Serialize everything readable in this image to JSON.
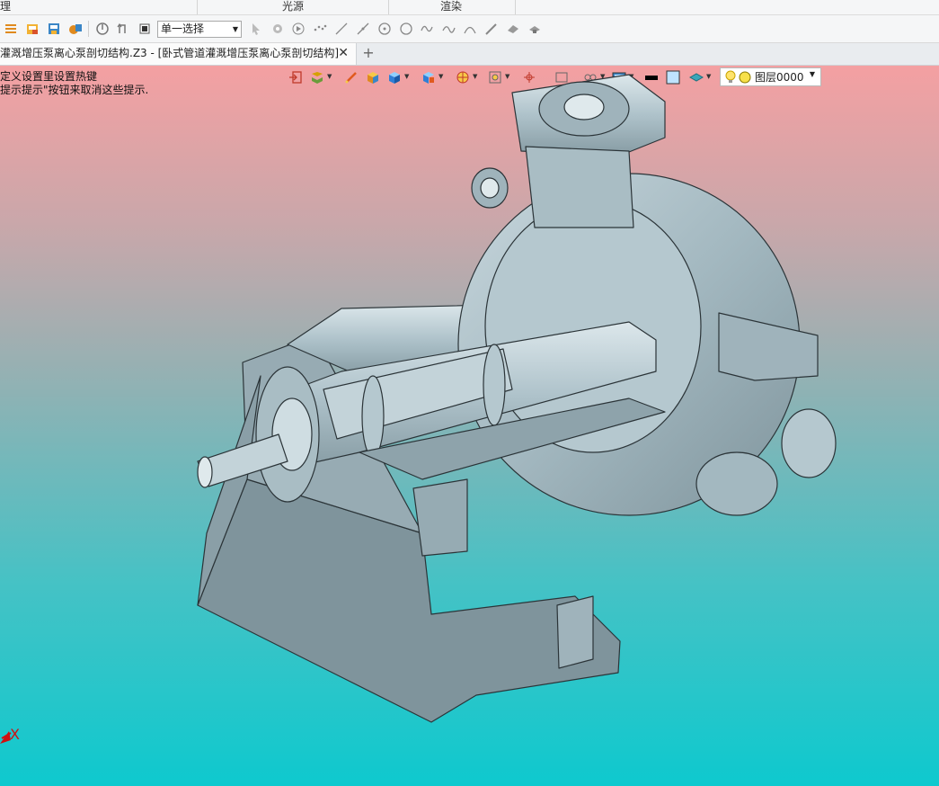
{
  "ribbon": {
    "groups": [
      "理",
      "光源",
      "渲染"
    ]
  },
  "toolbar": {
    "select_mode": "单一选择",
    "icons": [
      "new-icon",
      "open-icon",
      "save-icon",
      "recent-icon",
      "rotate-icon",
      "undo-icon",
      "stop-icon",
      "pick-icon",
      "snap-icon",
      "play-icon",
      "points-icon",
      "line-icon",
      "line2-icon",
      "circle-point-icon",
      "circle-icon",
      "wave-icon",
      "curve-icon",
      "arc-icon",
      "pen-icon",
      "eraser-icon",
      "hat-icon"
    ]
  },
  "tabs": {
    "document_title": "灌溉增压泵离心泵剖切结构.Z3 - [卧式管道灌溉增压泵离心泵剖切结构]",
    "close_glyph": "✕",
    "new_tab_glyph": "+"
  },
  "viewport": {
    "hint_line1": "定义设置里设置热键",
    "hint_line2": "提示提示\"按钮来取消这些提示.",
    "axis_x": "X",
    "layer": "图层0000",
    "colors": {
      "background_top": "#f4a0a2",
      "background_bottom": "#0ec9ce",
      "model": "#a8bcc4",
      "model_shadow": "#7f949c",
      "axis": "#d01010"
    }
  }
}
